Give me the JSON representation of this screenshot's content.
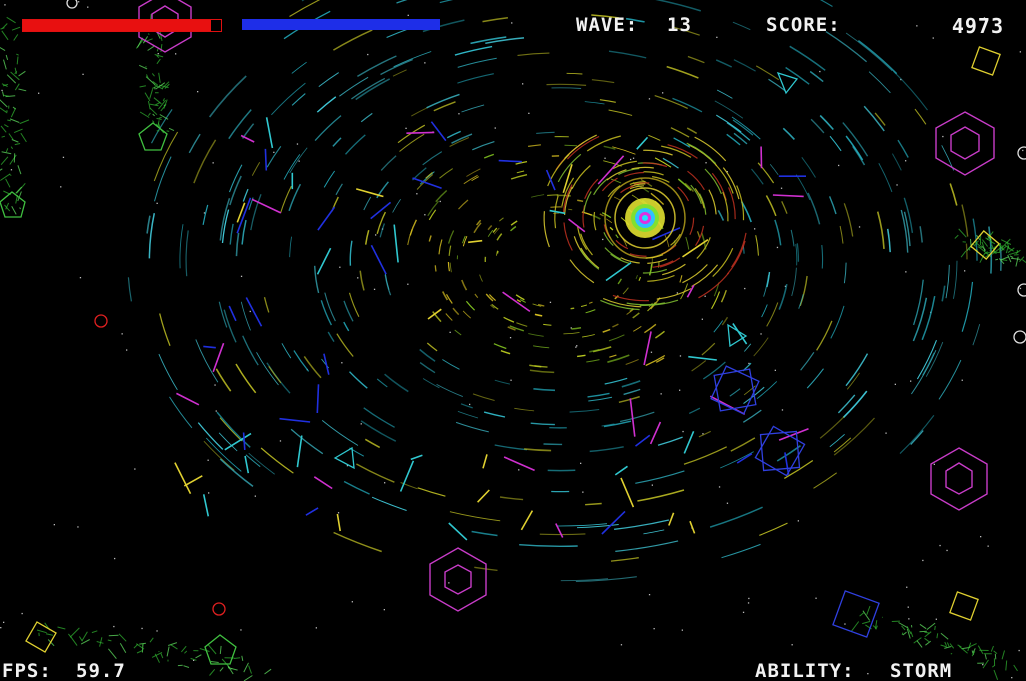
{
  "hud": {
    "health": 0.95,
    "energy": 1.0,
    "wave_label": "WAVE:",
    "wave_value": "13",
    "score_label": "SCORE:",
    "score_value": "4973",
    "fps_label": "FPS:",
    "fps_value": "59.7",
    "ability_label": "ABILITY:",
    "ability_value": "STORM"
  },
  "colors": {
    "background": "#000000",
    "health": "#e81010",
    "energy": "#1e2ee8",
    "enemy_hexagon": "#c83cc8",
    "enemy_square": "#3040e0",
    "enemy_diamond": "#e0d030",
    "enemy_triangle": "#30c8d0",
    "enemy_pentagon": "#40c040",
    "enemy_circle": "#e02020",
    "black_hole_core": "#20e0ff"
  },
  "icons": {
    "hexagon_enemy": "hexagon-icon",
    "square_enemy": "square-icon",
    "diamond_enemy": "diamond-icon",
    "triangle_enemy": "triangle-icon",
    "pentagon_enemy": "pentagon-icon",
    "circle_enemy": "circle-icon",
    "black_hole": "vortex-icon"
  }
}
